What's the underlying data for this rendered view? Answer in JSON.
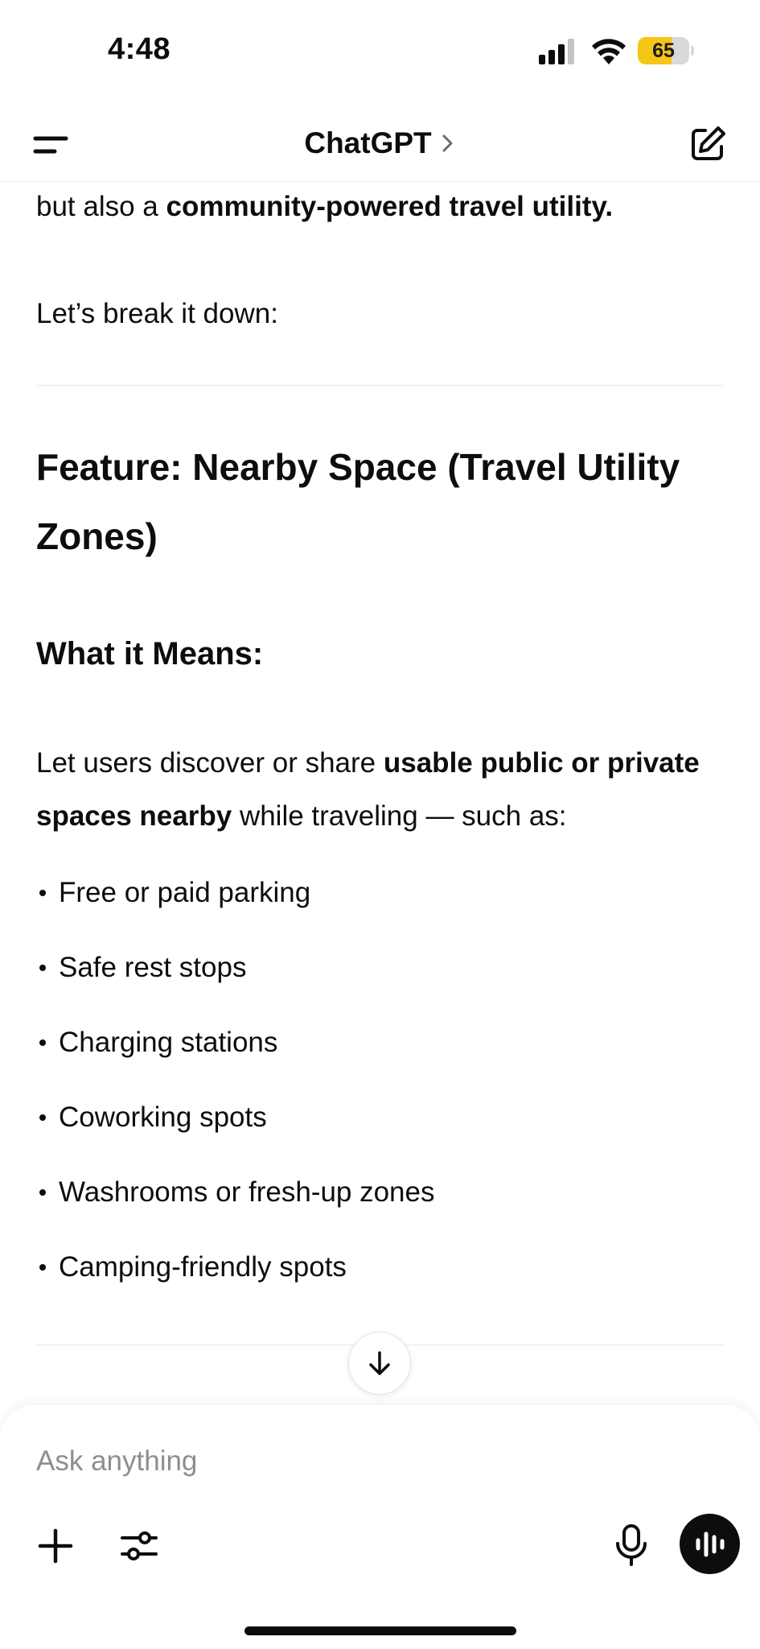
{
  "status_bar": {
    "time": "4:48",
    "battery": "65",
    "battery_level": 0.65
  },
  "nav": {
    "title": "ChatGPT",
    "icons": {
      "menu": "menu-icon",
      "chevron": "chevron-right-icon",
      "compose": "compose-icon"
    }
  },
  "content": {
    "intro_prefix": "but also a ",
    "intro_bold": "community-powered travel utility.",
    "breakdown": "Let’s break it down:",
    "heading": "Feature: Nearby Space (Travel Utility Zones)",
    "subheading": "What it Means:",
    "para_prefix": "Let users discover or share ",
    "para_bold": "usable public or private spaces nearby",
    "para_suffix": " while traveling — such as:",
    "list": [
      "Free or paid parking",
      "Safe rest stops",
      "Charging stations",
      "Coworking spots",
      "Washrooms or fresh-up zones",
      "Camping-friendly spots"
    ]
  },
  "composer": {
    "placeholder": "Ask anything",
    "icons": {
      "plus": "plus-icon",
      "tools": "sliders-icon",
      "mic": "microphone-icon",
      "voice": "voice-waveform-icon",
      "scroll": "arrow-down-icon"
    }
  }
}
